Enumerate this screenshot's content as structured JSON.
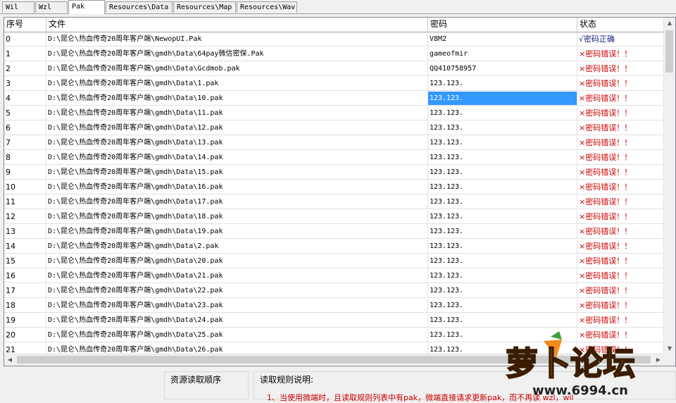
{
  "tabs": [
    {
      "label": "Wil",
      "active": false
    },
    {
      "label": "Wzl",
      "active": false
    },
    {
      "label": "Pak",
      "active": true
    },
    {
      "label": "Resources\\Data",
      "active": false
    },
    {
      "label": "Resources\\Map",
      "active": false
    },
    {
      "label": "Resources\\Wav",
      "active": false
    }
  ],
  "grid": {
    "headers": {
      "index": "序号",
      "file": "文件",
      "password": "密码",
      "status": "状态"
    },
    "rows": [
      {
        "index": "0",
        "file": "D:\\昆仑\\热血传奇20周年客户端\\NewopUI.Pak",
        "password": "V8M2",
        "status": "√密码正确",
        "ok": true
      },
      {
        "index": "1",
        "file": "D:\\昆仑\\热血传奇20周年客户端\\gmdh\\Data\\64pay微信密保.Pak",
        "password": "gameofmir",
        "status": "×密码错误！！",
        "ok": false
      },
      {
        "index": "2",
        "file": "D:\\昆仑\\热血传奇20周年客户端\\gmdh\\Data\\Gcdmob.pak",
        "password": "QQ410758957",
        "status": "×密码错误！！",
        "ok": false
      },
      {
        "index": "3",
        "file": "D:\\昆仑\\热血传奇20周年客户端\\gmdh\\Data\\1.pak",
        "password": "123.123.",
        "status": "×密码错误！！",
        "ok": false
      },
      {
        "index": "4",
        "file": "D:\\昆仑\\热血传奇20周年客户端\\gmdh\\Data\\10.pak",
        "password": "123.123.",
        "status": "×密码错误！！",
        "ok": false,
        "selected": true
      },
      {
        "index": "5",
        "file": "D:\\昆仑\\热血传奇20周年客户端\\gmdh\\Data\\11.pak",
        "password": "123.123.",
        "status": "×密码错误！！",
        "ok": false
      },
      {
        "index": "6",
        "file": "D:\\昆仑\\热血传奇20周年客户端\\gmdh\\Data\\12.pak",
        "password": "123.123.",
        "status": "×密码错误！！",
        "ok": false
      },
      {
        "index": "7",
        "file": "D:\\昆仑\\热血传奇20周年客户端\\gmdh\\Data\\13.pak",
        "password": "123.123.",
        "status": "×密码错误！！",
        "ok": false
      },
      {
        "index": "8",
        "file": "D:\\昆仑\\热血传奇20周年客户端\\gmdh\\Data\\14.pak",
        "password": "123.123.",
        "status": "×密码错误！！",
        "ok": false
      },
      {
        "index": "9",
        "file": "D:\\昆仑\\热血传奇20周年客户端\\gmdh\\Data\\15.pak",
        "password": "123.123.",
        "status": "×密码错误！！",
        "ok": false
      },
      {
        "index": "10",
        "file": "D:\\昆仑\\热血传奇20周年客户端\\gmdh\\Data\\16.pak",
        "password": "123.123.",
        "status": "×密码错误！！",
        "ok": false
      },
      {
        "index": "11",
        "file": "D:\\昆仑\\热血传奇20周年客户端\\gmdh\\Data\\17.pak",
        "password": "123.123.",
        "status": "×密码错误！！",
        "ok": false
      },
      {
        "index": "12",
        "file": "D:\\昆仑\\热血传奇20周年客户端\\gmdh\\Data\\18.pak",
        "password": "123.123.",
        "status": "×密码错误！！",
        "ok": false
      },
      {
        "index": "13",
        "file": "D:\\昆仑\\热血传奇20周年客户端\\gmdh\\Data\\19.pak",
        "password": "123.123.",
        "status": "×密码错误！！",
        "ok": false
      },
      {
        "index": "14",
        "file": "D:\\昆仑\\热血传奇20周年客户端\\gmdh\\Data\\2.pak",
        "password": "123.123.",
        "status": "×密码错误！！",
        "ok": false
      },
      {
        "index": "15",
        "file": "D:\\昆仑\\热血传奇20周年客户端\\gmdh\\Data\\20.pak",
        "password": "123.123.",
        "status": "×密码错误！！",
        "ok": false
      },
      {
        "index": "16",
        "file": "D:\\昆仑\\热血传奇20周年客户端\\gmdh\\Data\\21.pak",
        "password": "123.123.",
        "status": "×密码错误！！",
        "ok": false
      },
      {
        "index": "17",
        "file": "D:\\昆仑\\热血传奇20周年客户端\\gmdh\\Data\\22.pak",
        "password": "123.123.",
        "status": "×密码错误！！",
        "ok": false
      },
      {
        "index": "18",
        "file": "D:\\昆仑\\热血传奇20周年客户端\\gmdh\\Data\\23.pak",
        "password": "123.123.",
        "status": "×密码错误！！",
        "ok": false
      },
      {
        "index": "19",
        "file": "D:\\昆仑\\热血传奇20周年客户端\\gmdh\\Data\\24.pak",
        "password": "123.123.",
        "status": "×密码错误！！",
        "ok": false
      },
      {
        "index": "20",
        "file": "D:\\昆仑\\热血传奇20周年客户端\\gmdh\\Data\\25.pak",
        "password": "123.123.",
        "status": "×密码错误！！",
        "ok": false
      },
      {
        "index": "21",
        "file": "D:\\昆仑\\热血传奇20周年客户端\\gmdh\\Data\\26.pak",
        "password": "123.123.",
        "status": "×密码错误！！",
        "ok": false
      }
    ]
  },
  "panels": {
    "load_order_title": "资源读取顺序",
    "rules_title": "读取规则说明:",
    "rules_line1": "1、当使用微端时，且读取规则列表中有pak，微端直接请求更新pak，而不再读 wzl，wil"
  },
  "watermark": {
    "logo_text": "萝卜论坛",
    "site": "www.6994.cn"
  },
  "colors": {
    "ok": "#1a237e",
    "error": "#cc0000",
    "selection": "#3399ff",
    "logo_orange": "#f28a1c"
  }
}
